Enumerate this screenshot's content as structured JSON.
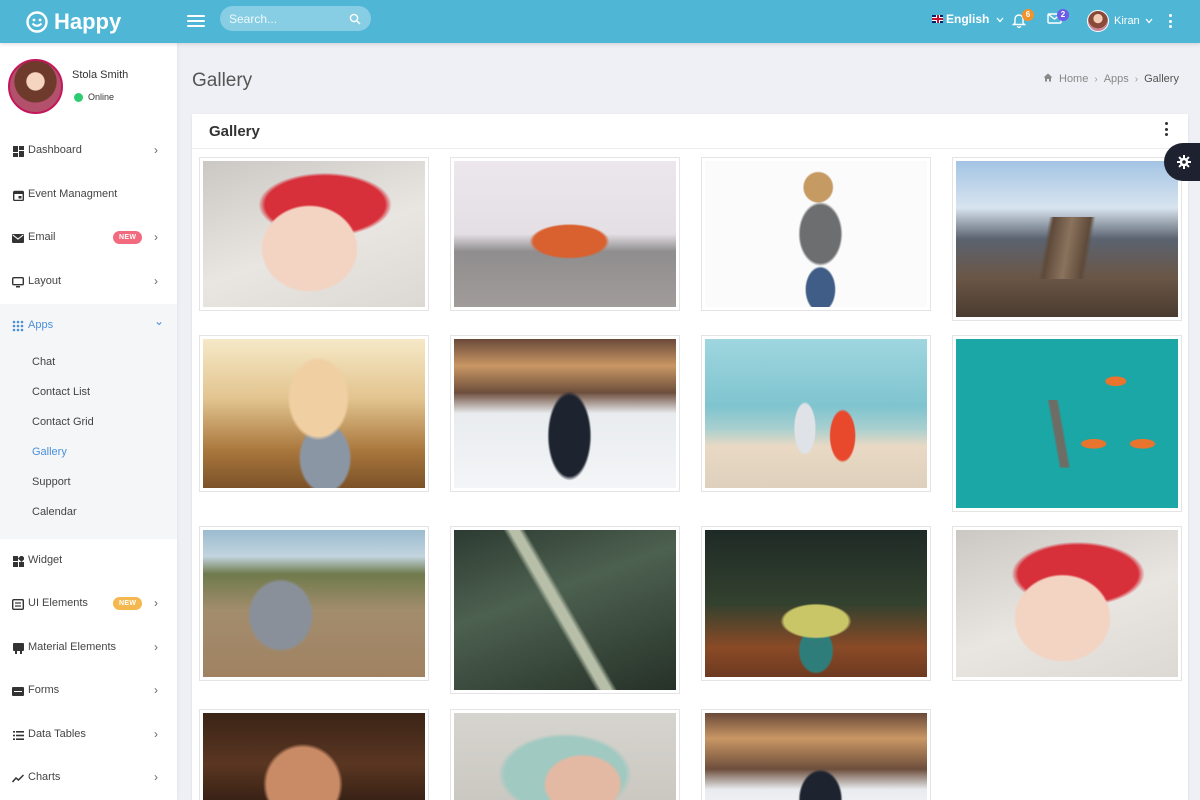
{
  "app": {
    "name": "Happy",
    "logo_icon": "smiley-icon"
  },
  "header": {
    "search_placeholder": "Search...",
    "language": "English",
    "notifications_count": "6",
    "messages_count": "2",
    "user_name": "Kiran",
    "colors": {
      "topbar": "#4fb6d6",
      "notif_badge": "#f0932b",
      "msg_badge": "#6c5ce7"
    }
  },
  "sidebar": {
    "profile": {
      "name": "Stola Smith",
      "status": "Online"
    },
    "items": [
      {
        "label": "Dashboard",
        "icon": "dashboard-icon",
        "chevron": "›"
      },
      {
        "label": "Event Managment",
        "icon": "calendar-icon"
      },
      {
        "label": "Email",
        "icon": "mail-icon",
        "badge": "NEW",
        "badge_color": "#f26a7e",
        "chevron": "›"
      },
      {
        "label": "Layout",
        "icon": "monitor-icon",
        "chevron": "›"
      },
      {
        "label": "Apps",
        "icon": "apps-icon",
        "chevron": "⌄",
        "expanded": true
      },
      {
        "label": "Widget",
        "icon": "widget-icon"
      },
      {
        "label": "UI Elements",
        "icon": "ui-elements-icon",
        "badge": "NEW",
        "badge_color": "#f5b74f",
        "chevron": "›"
      },
      {
        "label": "Material Elements",
        "icon": "material-icon",
        "chevron": "›"
      },
      {
        "label": "Forms",
        "icon": "forms-icon",
        "chevron": "›"
      },
      {
        "label": "Data Tables",
        "icon": "list-icon",
        "chevron": "›"
      },
      {
        "label": "Charts",
        "icon": "chart-line-icon",
        "chevron": "›"
      }
    ],
    "apps_submenu": [
      "Chat",
      "Contact List",
      "Contact Grid",
      "Gallery",
      "Support",
      "Calendar"
    ],
    "active_submenu": "Gallery"
  },
  "page": {
    "title": "Gallery",
    "breadcrumb": [
      "Home",
      "Apps",
      "Gallery"
    ],
    "card_title": "Gallery"
  },
  "gallery": [
    {
      "subject": "baby-santa-hat"
    },
    {
      "subject": "toy-van"
    },
    {
      "subject": "woman-sunglasses-white"
    },
    {
      "subject": "brooklyn-bridge"
    },
    {
      "subject": "blonde-woman-wheat"
    },
    {
      "subject": "woman-snow-splash"
    },
    {
      "subject": "couple-beach-run"
    },
    {
      "subject": "boats-aerial-turquoise"
    },
    {
      "subject": "bull-hillside"
    },
    {
      "subject": "grass-closeup"
    },
    {
      "subject": "person-yellow-umbrella"
    },
    {
      "subject": "baby-santa-hat"
    },
    {
      "subject": "curly-hair-woman"
    },
    {
      "subject": "baby-sleeping"
    },
    {
      "subject": "woman-snow-splash"
    }
  ]
}
